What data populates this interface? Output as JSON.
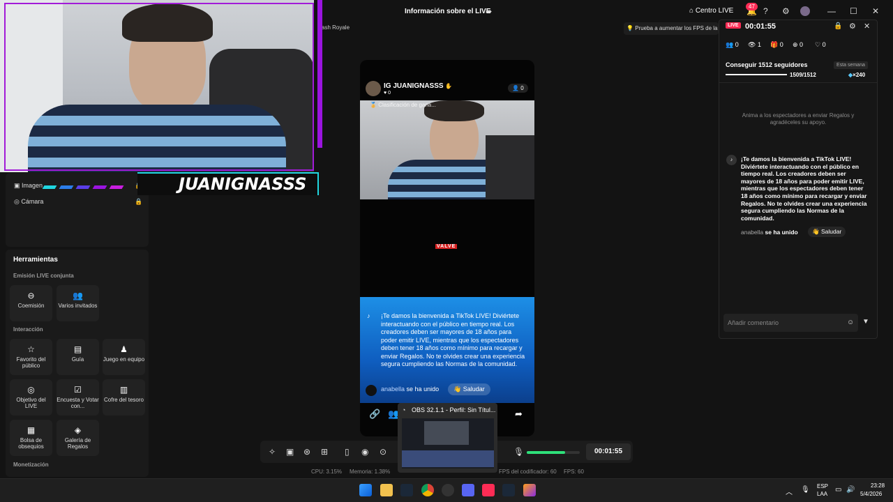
{
  "titlebar": {
    "live_info": "Información sobre el LIVE",
    "centro_live": "Centro LIVE",
    "notif_count": "47"
  },
  "hint": "Prueba a aumentar los FPS de la",
  "clash": "ash Royale",
  "webcam": {
    "name": "JUANIGNASSS"
  },
  "sidebar": {
    "sources": [
      {
        "label": "Imagen"
      },
      {
        "label": "Cámara"
      }
    ],
    "tools_title": "Herramientas",
    "sections": [
      {
        "title": "Emisión LIVE conjunta",
        "items": [
          "Coemisión",
          "Varios invitados"
        ]
      },
      {
        "title": "Interacción",
        "items": [
          "Favorito del público",
          "Guía",
          "Juego en equipo",
          "Objetivo del LIVE",
          "Encuesta y Votar con...",
          "Cofre del tesoro",
          "Bolsa de obsequios",
          "Galería de Regalos"
        ]
      },
      {
        "title": "Monetización",
        "items": []
      }
    ]
  },
  "phone": {
    "username": "IG JUANIGNASSS",
    "likes": "0",
    "viewers": "0",
    "rank": "Clasificación de gana...",
    "valve": "VALVE",
    "welcome": "¡Te damos la bienvenida a TikTok LIVE! Diviértete interactuando con el público en tiempo real. Los creadores deben ser mayores de 18 años para poder emitir LIVE, mientras que los espectadores deben tener 18 años como mínimo para recargar y enviar Regalos. No te olvides crear una experiencia segura cumpliendo las Normas de la comunidad.",
    "join_user": "anabella",
    "join_text": "se ha unido",
    "salud": "Saludar"
  },
  "obs_popup": {
    "title": "OBS 32.1.1 - Perfil: Sin Títul..."
  },
  "bottombar": {
    "timer": "00:01:55",
    "volume": 0.72,
    "stats": {
      "cpu": "CPU:  3.15%",
      "mem": "Memoria:  1.38%",
      "enc": "FPS del codificador:  60",
      "fps": "FPS:  60"
    }
  },
  "right_panel": {
    "live": "LIVE",
    "timer": "00:01:55",
    "stats": [
      "0",
      "1",
      "0",
      "0",
      "0"
    ],
    "goal": "Conseguir 1512 seguidores",
    "week": "Esta semana",
    "count": "1509/1512",
    "gems": "×240",
    "gift_hint": "Anima a los espectadores a enviar Regalos y agradéceles su apoyo.",
    "message": "¡Te damos la bienvenida a TikTok LIVE! Diviértete interactuando con el público en tiempo real. Los creadores deben ser mayores de 18 años para poder emitir LIVE, mientras que los espectadores deben tener 18 años como mínimo para recargar y enviar Regalos. No te olvides crear una experiencia segura cumpliendo las Normas de la comunidad.",
    "join_user": "anabella",
    "join_text": "se ha unido",
    "salud": "Saludar",
    "comment_placeholder": "Añadir comentario"
  },
  "taskbar": {
    "lang1": "ESP",
    "lang2": "LAA",
    "time": "23:28",
    "date": "5/4/2026"
  },
  "colors": {
    "accent": "#fe2c55",
    "purple": "#9b14e0",
    "cyan": "#20d6e0"
  }
}
